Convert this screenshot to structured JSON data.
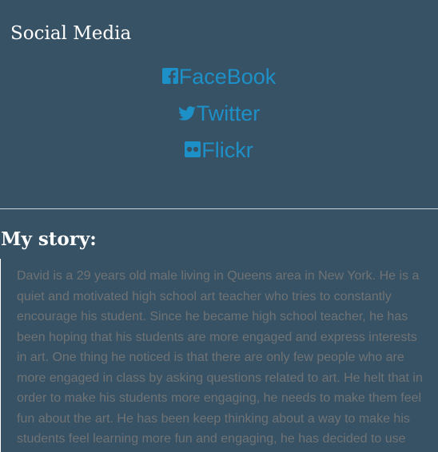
{
  "social": {
    "heading": "Social Media",
    "links": [
      {
        "label": "FaceBook",
        "icon": "facebook-icon"
      },
      {
        "label": "Twitter",
        "icon": "twitter-icon"
      },
      {
        "label": "Flickr",
        "icon": "flickr-icon"
      }
    ]
  },
  "story": {
    "heading": "My story:",
    "text": "David is a 29 years old male living in Queens area in New York. He is a quiet and motivated high school art teacher who tries to constantly encourage his student. Since he became high school teacher, he has been hoping that his students are more engaged and express interests in art. One thing he noticed is that there are only few people who are more engaged in class by asking questions related to art. He helt that in order to make his students more engaging, he needs to make them feel fun about the art. He has been keep thinking about a way to make his students feel learning more fun and engaging, he has decided to use"
  },
  "colors": {
    "background": "#375265",
    "link": "#1e90c8",
    "heading": "#ffffff",
    "story_text": "#6f7274"
  }
}
